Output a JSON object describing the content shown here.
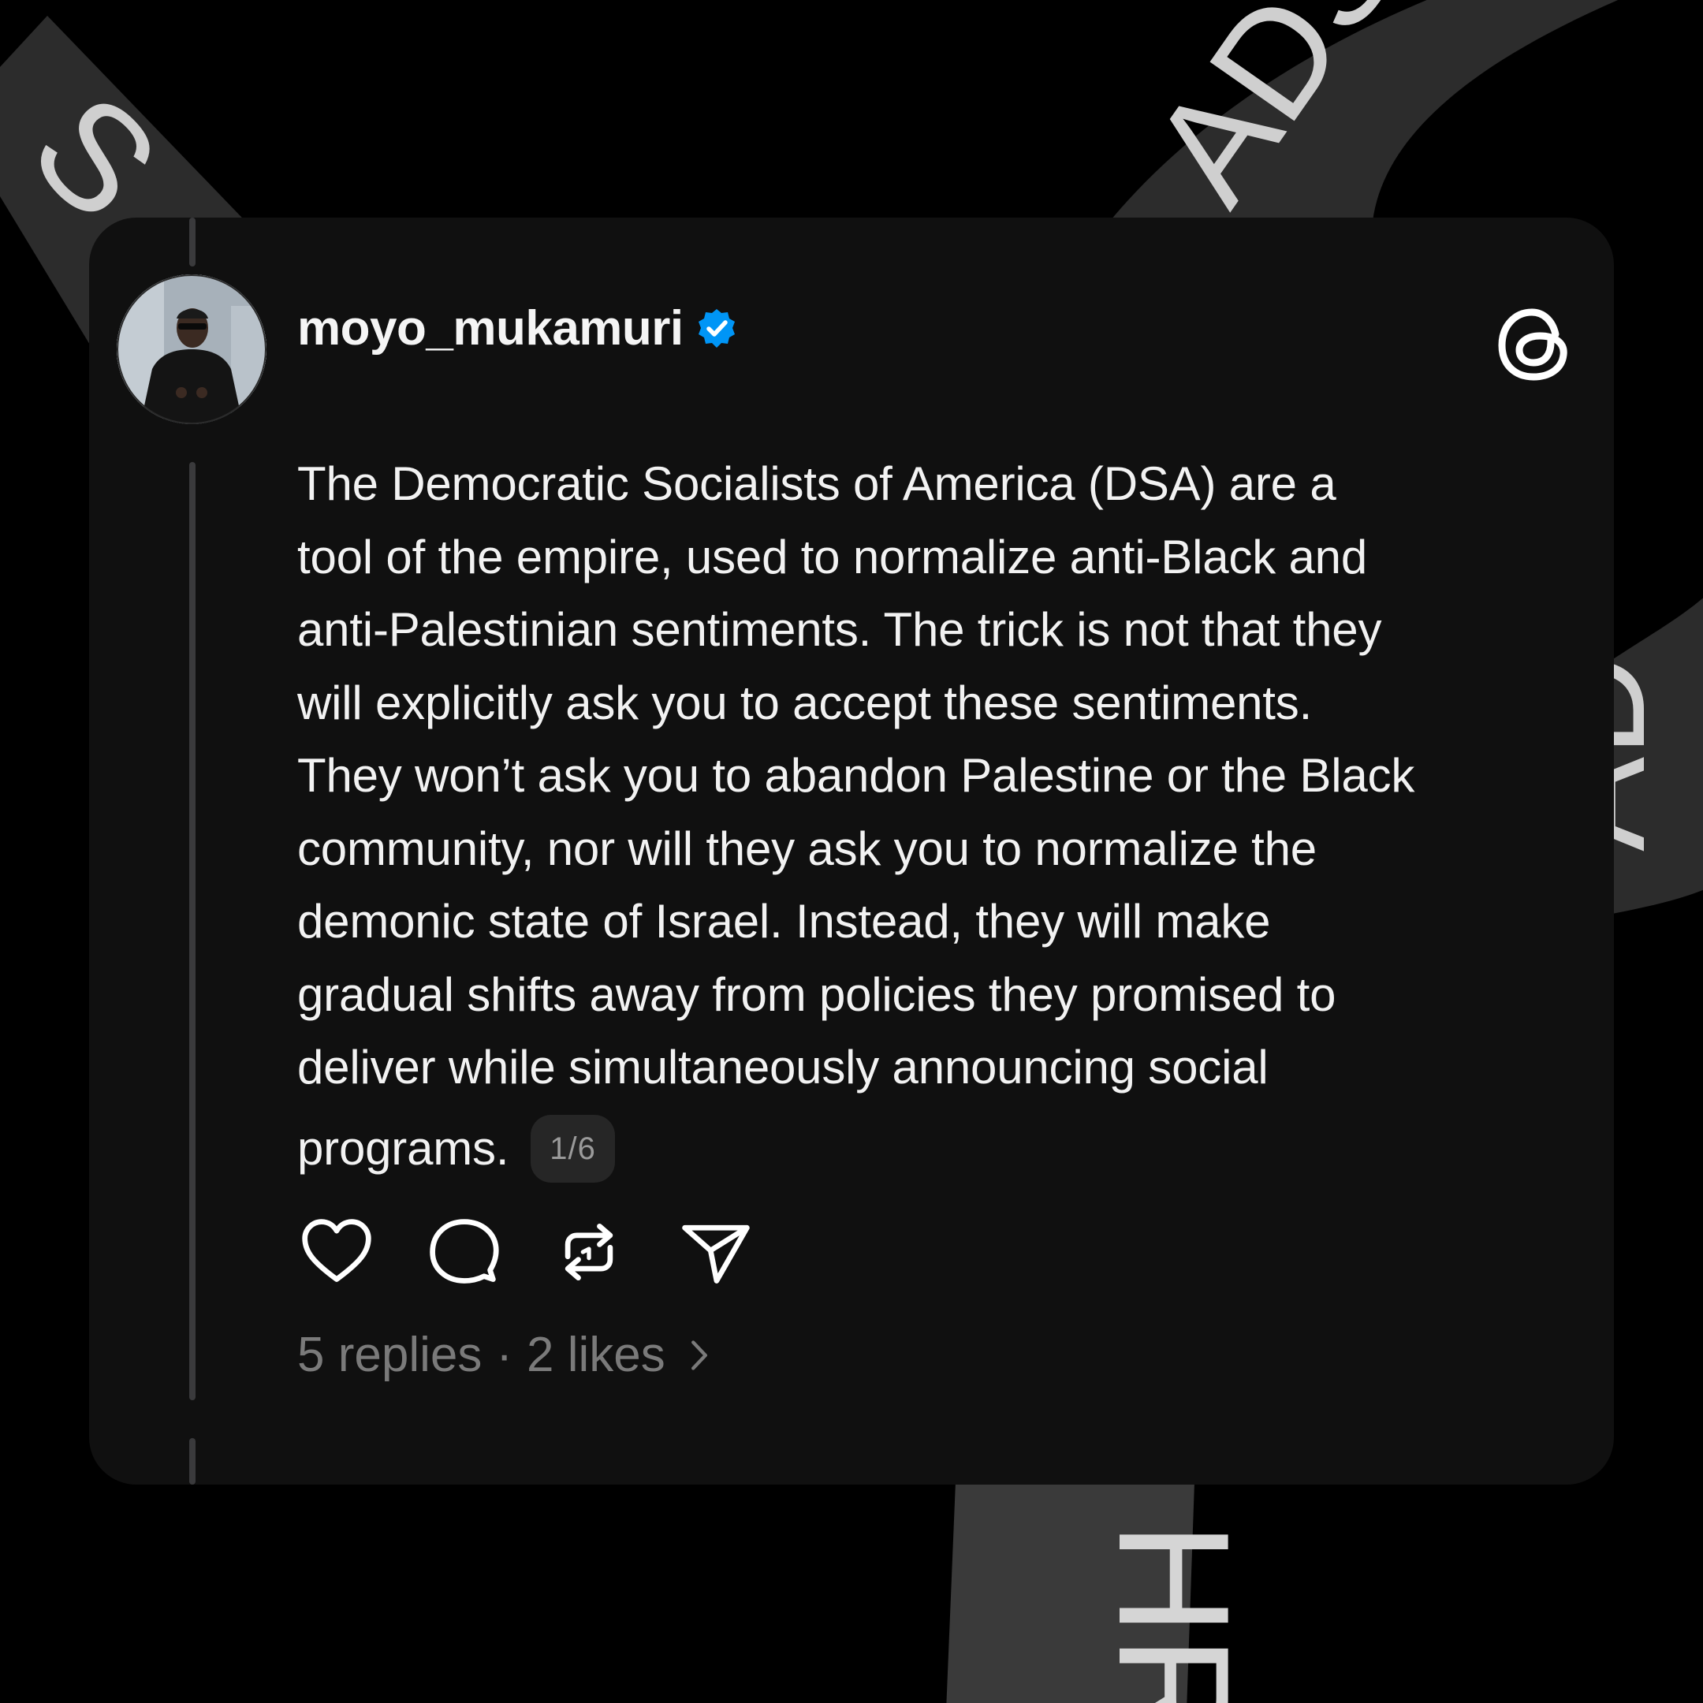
{
  "post": {
    "username": "moyo_mukamuri",
    "verified": true,
    "lines": [
      "The Democratic Socialists of America (DSA) are a",
      "tool of the empire, used to normalize anti-Black and",
      "anti-Palestinian sentiments. The trick is not that they",
      "will explicitly ask you to accept these sentiments.",
      "They won’t ask you to abandon Palestine or the Black",
      "community, nor will they ask you to normalize the",
      "demonic state of Israel. Instead, they will make",
      "gradual shifts away from policies they promised to",
      "deliver while simultaneously announcing social",
      "programs."
    ],
    "page_indicator": "1/6",
    "replies": "5 replies",
    "separator": "·",
    "likes": "2 likes"
  },
  "actions": [
    "heart-icon",
    "comment-icon",
    "repost-icon",
    "share-icon"
  ],
  "brand": {
    "logo": "threads-icon",
    "verified_color": "#0095f6"
  },
  "background": {
    "ribbon_text": [
      "S",
      "ADS",
      "AD",
      "HR"
    ]
  }
}
